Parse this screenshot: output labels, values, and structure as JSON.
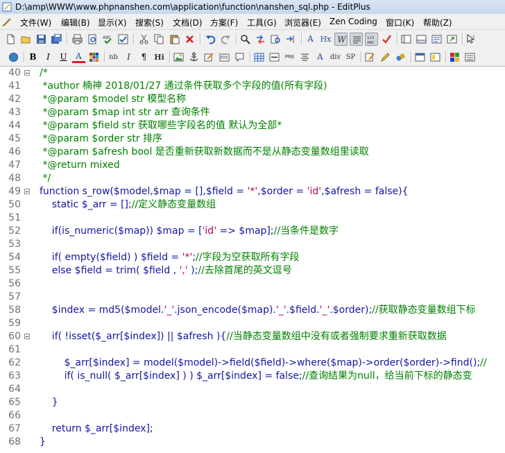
{
  "window": {
    "title": "D:\\amp\\WWW\\www.phpnanshen.com\\application\\function\\nanshen_sql.php - EditPlus"
  },
  "menu": {
    "items": [
      "文件(W)",
      "编辑(B)",
      "显示(X)",
      "搜索(S)",
      "文档(D)",
      "方案(F)",
      "工具(G)",
      "浏览器(E)",
      "Zen Coding",
      "窗口(K)",
      "帮助(Z)"
    ]
  },
  "toolbar2": {
    "bold": "B",
    "italic": "I",
    "underline": "U",
    "font_color": "A",
    "nbsp": "nb",
    "italic_tag": "I",
    "para": "¶",
    "heading": "Hi",
    "pre": "PRE",
    "heading2": "Hx",
    "div": "div",
    "span": "SP"
  },
  "colors": {
    "comment": "#008000",
    "string": "#b00060",
    "code": "#1414a0",
    "line_number": "#707070"
  },
  "editor": {
    "lines": [
      {
        "n": "40",
        "fold": true,
        "text": "/*"
      },
      {
        "n": "41",
        "fold": false,
        "text": " *author 楠神 2018/01/27 通过条件获取多个字段的值(所有字段)"
      },
      {
        "n": "42",
        "fold": false,
        "text": " *@param $model str 模型名称"
      },
      {
        "n": "43",
        "fold": false,
        "text": " *@param $map int str arr 查询条件"
      },
      {
        "n": "44",
        "fold": false,
        "text": " *@param $field str 获取哪些字段名的值 默认为全部*"
      },
      {
        "n": "45",
        "fold": false,
        "text": " *@param $order str 排序"
      },
      {
        "n": "46",
        "fold": false,
        "text": " *@param $afresh bool 是否重新获取新数据而不是从静态变量数组里读取"
      },
      {
        "n": "47",
        "fold": false,
        "text": " *@return mixed"
      },
      {
        "n": "48",
        "fold": false,
        "text": " */"
      },
      {
        "n": "49",
        "fold": true,
        "text": "function s_row($model,$map = [],$field = '*',$order = 'id',$afresh = false){"
      },
      {
        "n": "50",
        "fold": false,
        "text": "    static $_arr = [];//定义静态变量数组"
      },
      {
        "n": "51",
        "fold": false,
        "text": ""
      },
      {
        "n": "52",
        "fold": false,
        "text": "    if(is_numeric($map)) $map = ['id' => $map];//当条件是数字"
      },
      {
        "n": "53",
        "fold": false,
        "text": ""
      },
      {
        "n": "54",
        "fold": false,
        "text": "    if( empty($field) ) $field = '*';//字段为空获取所有字段"
      },
      {
        "n": "55",
        "fold": false,
        "text": "    else $field = trim( $field , ',' );//去除首尾的英文逗号"
      },
      {
        "n": "56",
        "fold": false,
        "text": ""
      },
      {
        "n": "57",
        "fold": false,
        "text": ""
      },
      {
        "n": "58",
        "fold": false,
        "text": "    $index = md5($model.'_'.json_encode($map).'_'.$field.'_'.$order);//获取静态变量数组下标"
      },
      {
        "n": "59",
        "fold": false,
        "text": ""
      },
      {
        "n": "60",
        "fold": true,
        "text": "    if( !isset($_arr[$index]) || $afresh ){//当静态变量数组中没有或者强制要求重新获取数据"
      },
      {
        "n": "61",
        "fold": false,
        "text": ""
      },
      {
        "n": "62",
        "fold": false,
        "text": "        $_arr[$index] = model($model)->field($field)->where($map)->order($order)->find();//"
      },
      {
        "n": "63",
        "fold": false,
        "text": "        if( is_null( $_arr[$index] ) ) $_arr[$index] = false;//查询结果为null，给当前下标的静态变"
      },
      {
        "n": "64",
        "fold": false,
        "text": ""
      },
      {
        "n": "65",
        "fold": false,
        "text": "    }"
      },
      {
        "n": "66",
        "fold": false,
        "text": ""
      },
      {
        "n": "67",
        "fold": false,
        "text": "    return $_arr[$index];"
      },
      {
        "n": "68",
        "fold": false,
        "text": "}"
      }
    ]
  }
}
